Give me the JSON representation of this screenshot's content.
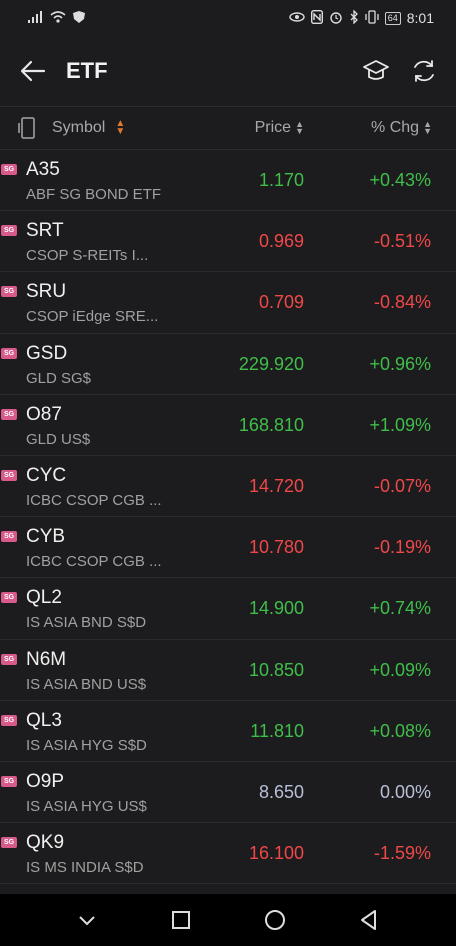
{
  "status_bar": {
    "time": "8:01",
    "battery": "64"
  },
  "app_bar": {
    "title": "ETF",
    "back_icon": "arrow-left-icon",
    "learn_icon": "graduation-cap-icon",
    "refresh_icon": "refresh-icon"
  },
  "header": {
    "symbol": "Symbol",
    "price": "Price",
    "chg": "% Chg"
  },
  "colors": {
    "up": "#3fbf4a",
    "down": "#f04848",
    "flat": "#b8bfd8",
    "badge": "#d75a8a",
    "sort_accent": "#e0772a"
  },
  "rows": [
    {
      "badge": "SG",
      "symbol": "A35",
      "name": "ABF SG BOND ETF",
      "price": "1.170",
      "chg": "+0.43%",
      "dir": "up"
    },
    {
      "badge": "SG",
      "symbol": "SRT",
      "name": "CSOP S-REITs I...",
      "price": "0.969",
      "chg": "-0.51%",
      "dir": "down"
    },
    {
      "badge": "SG",
      "symbol": "SRU",
      "name": "CSOP iEdge SRE...",
      "price": "0.709",
      "chg": "-0.84%",
      "dir": "down"
    },
    {
      "badge": "SG",
      "symbol": "GSD",
      "name": "GLD SG$",
      "price": "229.920",
      "chg": "+0.96%",
      "dir": "up"
    },
    {
      "badge": "SG",
      "symbol": "O87",
      "name": "GLD US$",
      "price": "168.810",
      "chg": "+1.09%",
      "dir": "up"
    },
    {
      "badge": "SG",
      "symbol": "CYC",
      "name": "ICBC CSOP CGB ...",
      "price": "14.720",
      "chg": "-0.07%",
      "dir": "down"
    },
    {
      "badge": "SG",
      "symbol": "CYB",
      "name": "ICBC CSOP CGB ...",
      "price": "10.780",
      "chg": "-0.19%",
      "dir": "down"
    },
    {
      "badge": "SG",
      "symbol": "QL2",
      "name": "IS ASIA BND S$D",
      "price": "14.900",
      "chg": "+0.74%",
      "dir": "up"
    },
    {
      "badge": "SG",
      "symbol": "N6M",
      "name": "IS ASIA BND US$",
      "price": "10.850",
      "chg": "+0.09%",
      "dir": "up"
    },
    {
      "badge": "SG",
      "symbol": "QL3",
      "name": "IS ASIA HYG S$D",
      "price": "11.810",
      "chg": "+0.08%",
      "dir": "up"
    },
    {
      "badge": "SG",
      "symbol": "O9P",
      "name": "IS ASIA HYG US$",
      "price": "8.650",
      "chg": "0.00%",
      "dir": "flat"
    },
    {
      "badge": "SG",
      "symbol": "QK9",
      "name": "IS MS INDIA S$D",
      "price": "16.100",
      "chg": "-1.59%",
      "dir": "down"
    }
  ]
}
